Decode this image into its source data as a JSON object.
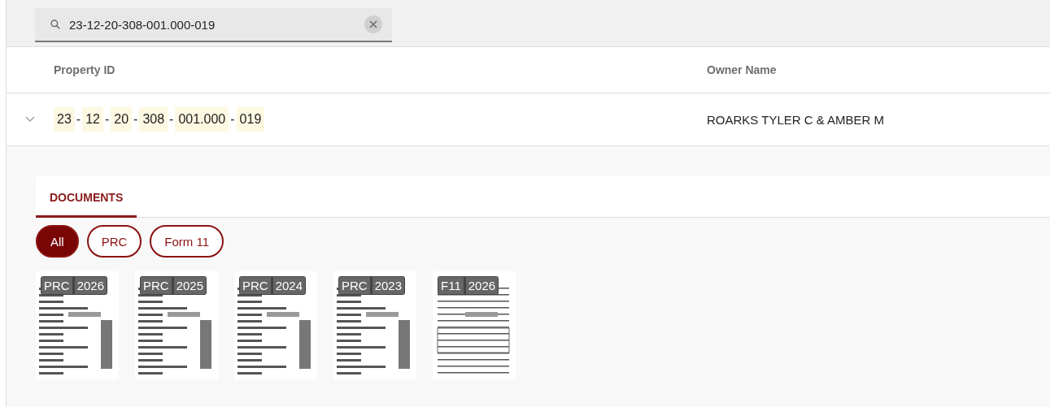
{
  "search": {
    "value": "23-12-20-308-001.000-019"
  },
  "table": {
    "columns": [
      "Property ID",
      "Owner Name"
    ],
    "rows": [
      {
        "expanded": true,
        "property_id": [
          {
            "kind": "match",
            "text": "23"
          },
          {
            "kind": "sep",
            "text": "-"
          },
          {
            "kind": "match",
            "text": "12"
          },
          {
            "kind": "sep",
            "text": "-"
          },
          {
            "kind": "match",
            "text": "20"
          },
          {
            "kind": "sep",
            "text": "-"
          },
          {
            "kind": "match",
            "text": "308"
          },
          {
            "kind": "sep",
            "text": "-"
          },
          {
            "kind": "match",
            "text": "001.000"
          },
          {
            "kind": "sep",
            "text": "-"
          },
          {
            "kind": "match",
            "text": "019"
          }
        ],
        "owner_name": "ROARKS TYLER C & AMBER M"
      }
    ]
  },
  "documents": {
    "tabs": [
      {
        "label": "DOCUMENTS",
        "selected": true
      }
    ],
    "filters": [
      {
        "label": "All",
        "selected": true
      },
      {
        "label": "PRC",
        "selected": false
      },
      {
        "label": "Form 11",
        "selected": false
      }
    ],
    "items": [
      {
        "type": "PRC",
        "year": "2026"
      },
      {
        "type": "PRC",
        "year": "2025"
      },
      {
        "type": "PRC",
        "year": "2024"
      },
      {
        "type": "PRC",
        "year": "2023"
      },
      {
        "type": "F11",
        "year": "2026"
      }
    ]
  }
}
